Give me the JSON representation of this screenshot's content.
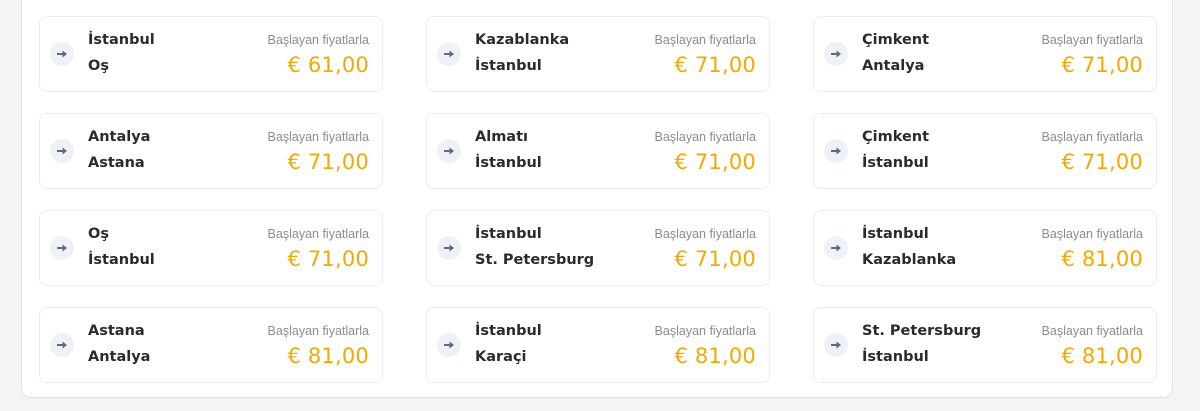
{
  "accent_color": "#f2a900",
  "icon": "arrow-right-icon",
  "routes": [
    {
      "from": "İstanbul",
      "to": "Oş",
      "label": "Başlayan fiyatlarla",
      "price": "€ 61,00"
    },
    {
      "from": "Kazablanka",
      "to": "İstanbul",
      "label": "Başlayan fiyatlarla",
      "price": "€ 71,00"
    },
    {
      "from": "Çimkent",
      "to": "Antalya",
      "label": "Başlayan fiyatlarla",
      "price": "€ 71,00"
    },
    {
      "from": "Antalya",
      "to": "Astana",
      "label": "Başlayan fiyatlarla",
      "price": "€ 71,00"
    },
    {
      "from": "Almatı",
      "to": "İstanbul",
      "label": "Başlayan fiyatlarla",
      "price": "€ 71,00"
    },
    {
      "from": "Çimkent",
      "to": "İstanbul",
      "label": "Başlayan fiyatlarla",
      "price": "€ 71,00"
    },
    {
      "from": "Oş",
      "to": "İstanbul",
      "label": "Başlayan fiyatlarla",
      "price": "€ 71,00"
    },
    {
      "from": "İstanbul",
      "to": "St. Petersburg",
      "label": "Başlayan fiyatlarla",
      "price": "€ 71,00"
    },
    {
      "from": "İstanbul",
      "to": "Kazablanka",
      "label": "Başlayan fiyatlarla",
      "price": "€ 81,00"
    },
    {
      "from": "Astana",
      "to": "Antalya",
      "label": "Başlayan fiyatlarla",
      "price": "€ 81,00"
    },
    {
      "from": "İstanbul",
      "to": "Karaçi",
      "label": "Başlayan fiyatlarla",
      "price": "€ 81,00"
    },
    {
      "from": "St. Petersburg",
      "to": "İstanbul",
      "label": "Başlayan fiyatlarla",
      "price": "€ 81,00"
    }
  ]
}
